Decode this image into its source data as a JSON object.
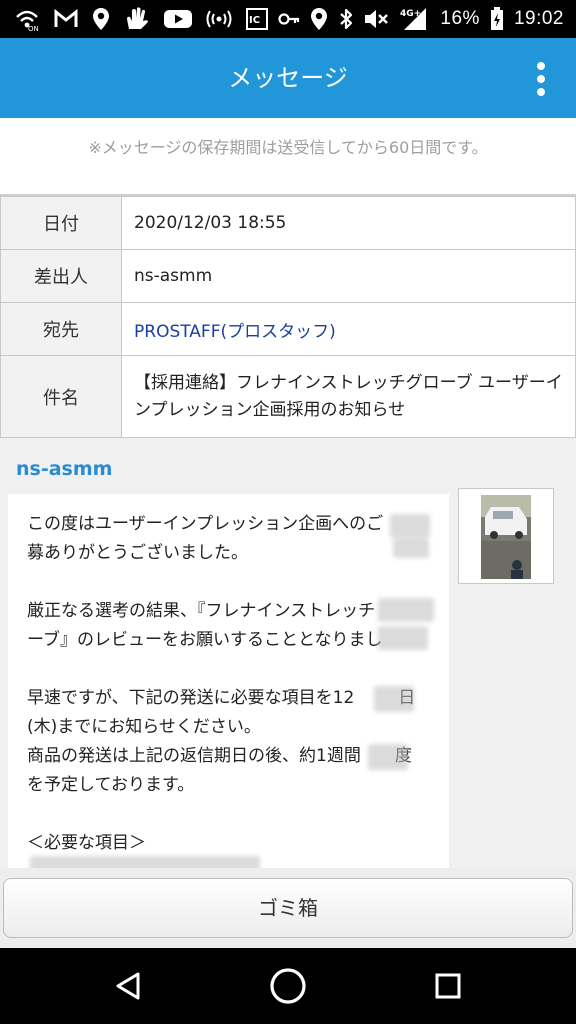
{
  "statusbar": {
    "battery_percent": "16%",
    "time": "19:02",
    "network": "4G+",
    "left_icons": [
      "wifi-calling-icon",
      "gmail-icon",
      "location-icon",
      "hand-icon",
      "youtube-icon",
      "hotspot-icon"
    ],
    "right_icons": [
      "nfc-icon",
      "key-icon",
      "location-icon",
      "bluetooth-icon",
      "mute-icon",
      "signal-icon",
      "battery-icon"
    ]
  },
  "appbar": {
    "title": "メッセージ",
    "menu_icon": "more-vert-icon"
  },
  "notice": "※メッセージの保存期間は送受信してから60日間です。",
  "meta": {
    "date_label": "日付",
    "date_value": "2020/12/03 18:55",
    "from_label": "差出人",
    "from_value": "ns-asmm",
    "to_label": "宛先",
    "to_value": "PROSTAFF(プロスタッフ)",
    "subject_label": "件名",
    "subject_value": "【採用連絡】フレナインストレッチグローブ ユーザーインプレッション企画採用のお知らせ"
  },
  "message": {
    "sender": "ns-asmm",
    "line1": "この度はユーザーインプレッション企画へのご",
    "line2": "募ありがとうございました。",
    "line3": "厳正なる選考の結果、『フレナインストレッチ",
    "line4": "ーブ』のレビューをお願いすることとなりまし",
    "line5": "早速ですが、下記の発送に必要な項目を12",
    "line5b": "日",
    "line6": "(木)までにお知らせください。",
    "line7": "商品の発送は上記の返信期日の後、約1週間",
    "line7b": "度",
    "line8": "を予定しております。",
    "line9": "＜必要な項目＞"
  },
  "trash_button": "ゴミ箱",
  "colors": {
    "appbar": "#2196d8",
    "sender": "#2a8bd0",
    "link": "#1a3f9e"
  },
  "navbar": {
    "back_icon": "back-triangle-icon",
    "home_icon": "home-circle-icon",
    "recents_icon": "recents-square-icon"
  }
}
